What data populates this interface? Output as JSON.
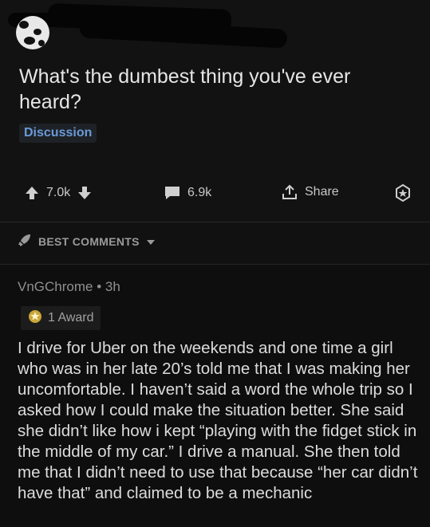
{
  "post": {
    "title": "What's the dumbest thing you've ever heard?",
    "flair": "Discussion"
  },
  "actions": {
    "upvotes": "7.0k",
    "comments": "6.9k",
    "share_label": "Share"
  },
  "sort": {
    "label": "BEST COMMENTS"
  },
  "comment": {
    "author": "VnGChrome",
    "separator": "•",
    "age": "3h",
    "award_label": "1 Award",
    "body": "I drive for Uber on the weekends and one time a girl who was in her late 20’s told me that I was making her uncomfortable. I haven’t said a word the whole trip so I asked how I could make the situation better. She said she didn’t like how i kept “playing with the fidget stick in the middle of my car.” I drive a manual. She then told me that I didn’t need to use that because “her car didn’t have that” and claimed to be a mechanic"
  },
  "icons": [
    "avatar",
    "upvote-icon",
    "downvote-icon",
    "comment-icon",
    "share-icon",
    "award-icon",
    "rocket-icon",
    "chevron-down-icon",
    "award-badge-icon"
  ],
  "colors": {
    "background": "#111111",
    "flair_text": "#6a9bd8",
    "text": "#d7dadc",
    "muted": "#8f8f8f"
  }
}
